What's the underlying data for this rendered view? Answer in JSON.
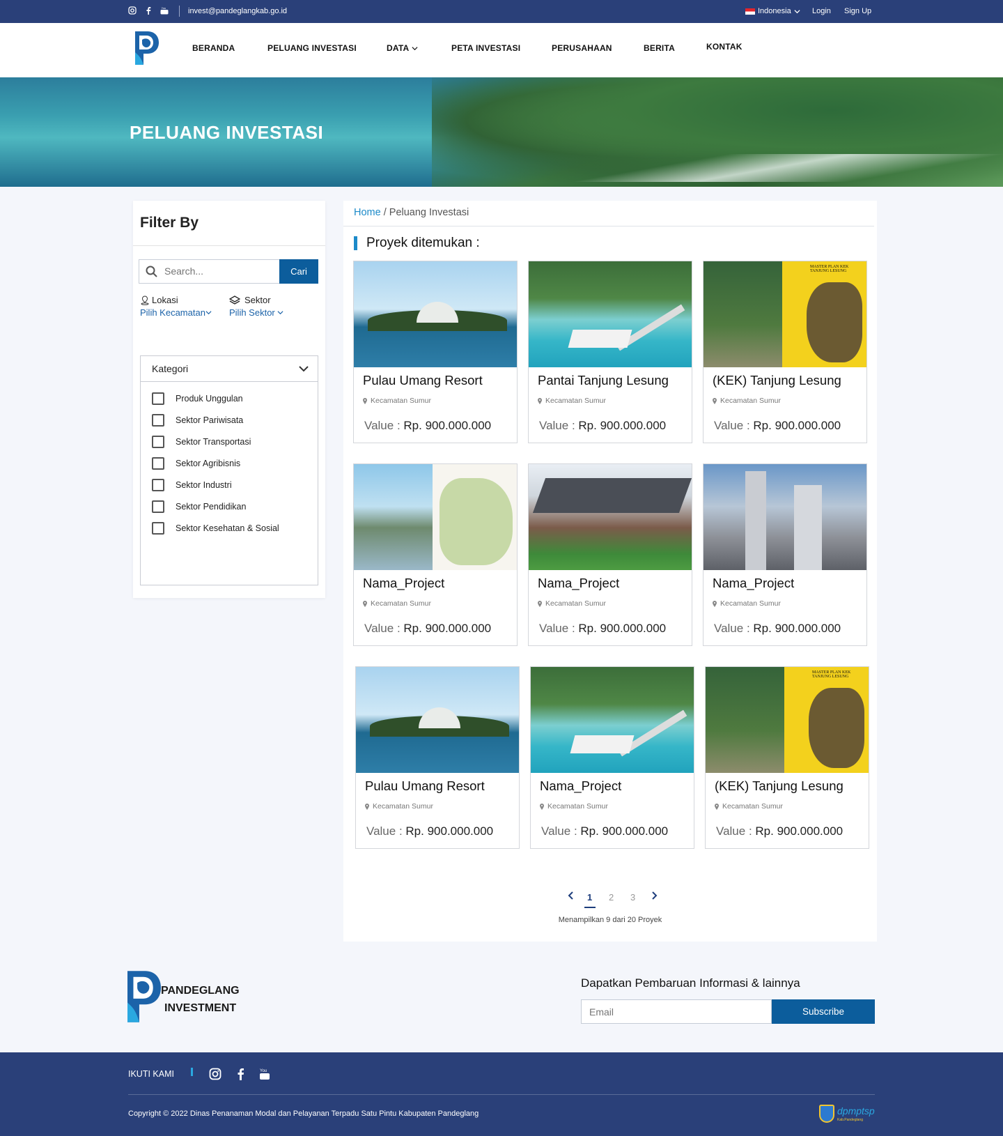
{
  "topbar": {
    "email": "invest@pandeglangkab.go.id",
    "language": "Indonesia",
    "login": "Login",
    "signup": "Sign Up",
    "social_icons": [
      "instagram-icon",
      "facebook-icon",
      "youtube-icon"
    ]
  },
  "nav": {
    "items": [
      "BERANDA",
      "PELUANG INVESTASI",
      "DATA",
      "PETA INVESTASI",
      "PERUSAHAAN",
      "BERITA",
      "KONTAK"
    ]
  },
  "hero": {
    "title": "PELUANG INVESTASI"
  },
  "filter": {
    "title": "Filter By",
    "search_placeholder": "Search...",
    "search_button": "Cari",
    "lokasi_label": "Lokasi",
    "lokasi_pick": "Pilih Kecamatan",
    "sektor_label": "Sektor",
    "sektor_pick": "Pilih Sektor",
    "kategori_title": "Kategori",
    "kategori": [
      "Produk Unggulan",
      "Sektor Pariwisata",
      "Sektor Transportasi",
      "Sektor Agribisnis",
      "Sektor Industri",
      "Sektor Pendidikan",
      "Sektor Kesehatan & Sosial"
    ]
  },
  "main": {
    "breadcrumb_home": "Home",
    "breadcrumb_sep": " / ",
    "breadcrumb_current": "Peluang Investasi",
    "found_label": "Proyek ditemukan :",
    "value_label": "Value :",
    "projects": [
      {
        "title": "Pulau Umang Resort",
        "location": "Kecamatan Sumur",
        "value": "Rp. 900.000.000",
        "image": "resort"
      },
      {
        "title": "Pantai Tanjung Lesung",
        "location": "Kecamatan Sumur",
        "value": "Rp. 900.000.000",
        "image": "beach"
      },
      {
        "title": "(KEK) Tanjung Lesung",
        "location": "Kecamatan Sumur",
        "value": "Rp. 900.000.000",
        "image": "kek"
      },
      {
        "title": "Nama_Project",
        "location": "Kecamatan Sumur",
        "value": "Rp. 900.000.000",
        "image": "infra"
      },
      {
        "title": "Nama_Project",
        "location": "Kecamatan Sumur",
        "value": "Rp. 900.000.000",
        "image": "house"
      },
      {
        "title": "Nama_Project",
        "location": "Kecamatan Sumur",
        "value": "Rp. 900.000.000",
        "image": "plant"
      },
      {
        "title": "Pulau Umang Resort",
        "location": "Kecamatan Sumur",
        "value": "Rp. 900.000.000",
        "image": "resort"
      },
      {
        "title": "Nama_Project",
        "location": "Kecamatan Sumur",
        "value": "Rp. 900.000.000",
        "image": "beach"
      },
      {
        "title": "(KEK) Tanjung Lesung",
        "location": "Kecamatan Sumur",
        "value": "Rp. 900.000.000",
        "image": "kek"
      }
    ],
    "kek_image_text": "MASTER PLAN KEK TANJUNG LESUNG",
    "pagination": {
      "pages": [
        "1",
        "2",
        "3"
      ],
      "current": "1"
    },
    "showing": "Menampilkan 9 dari 20 Proyek"
  },
  "footer": {
    "brand_line1": "PANDEGLANG",
    "brand_line2": "INVESTMENT",
    "update_title": "Dapatkan Pembaruan Informasi & lainnya",
    "email_placeholder": "Email",
    "subscribe": "Subscribe",
    "ikuti": "IKUTI KAMI",
    "copyright": "Copyright © 2022 Dinas Penanaman Modal dan Pelayanan Terpadu Satu Pintu Kabupaten Pandeglang",
    "dpm_logo_text": "dpmptsp",
    "dpm_logo_sub": "Kab.Pandeglang"
  },
  "colors": {
    "navy": "#2a4079",
    "accent": "#0c5d9c",
    "link": "#1c8ac9"
  }
}
